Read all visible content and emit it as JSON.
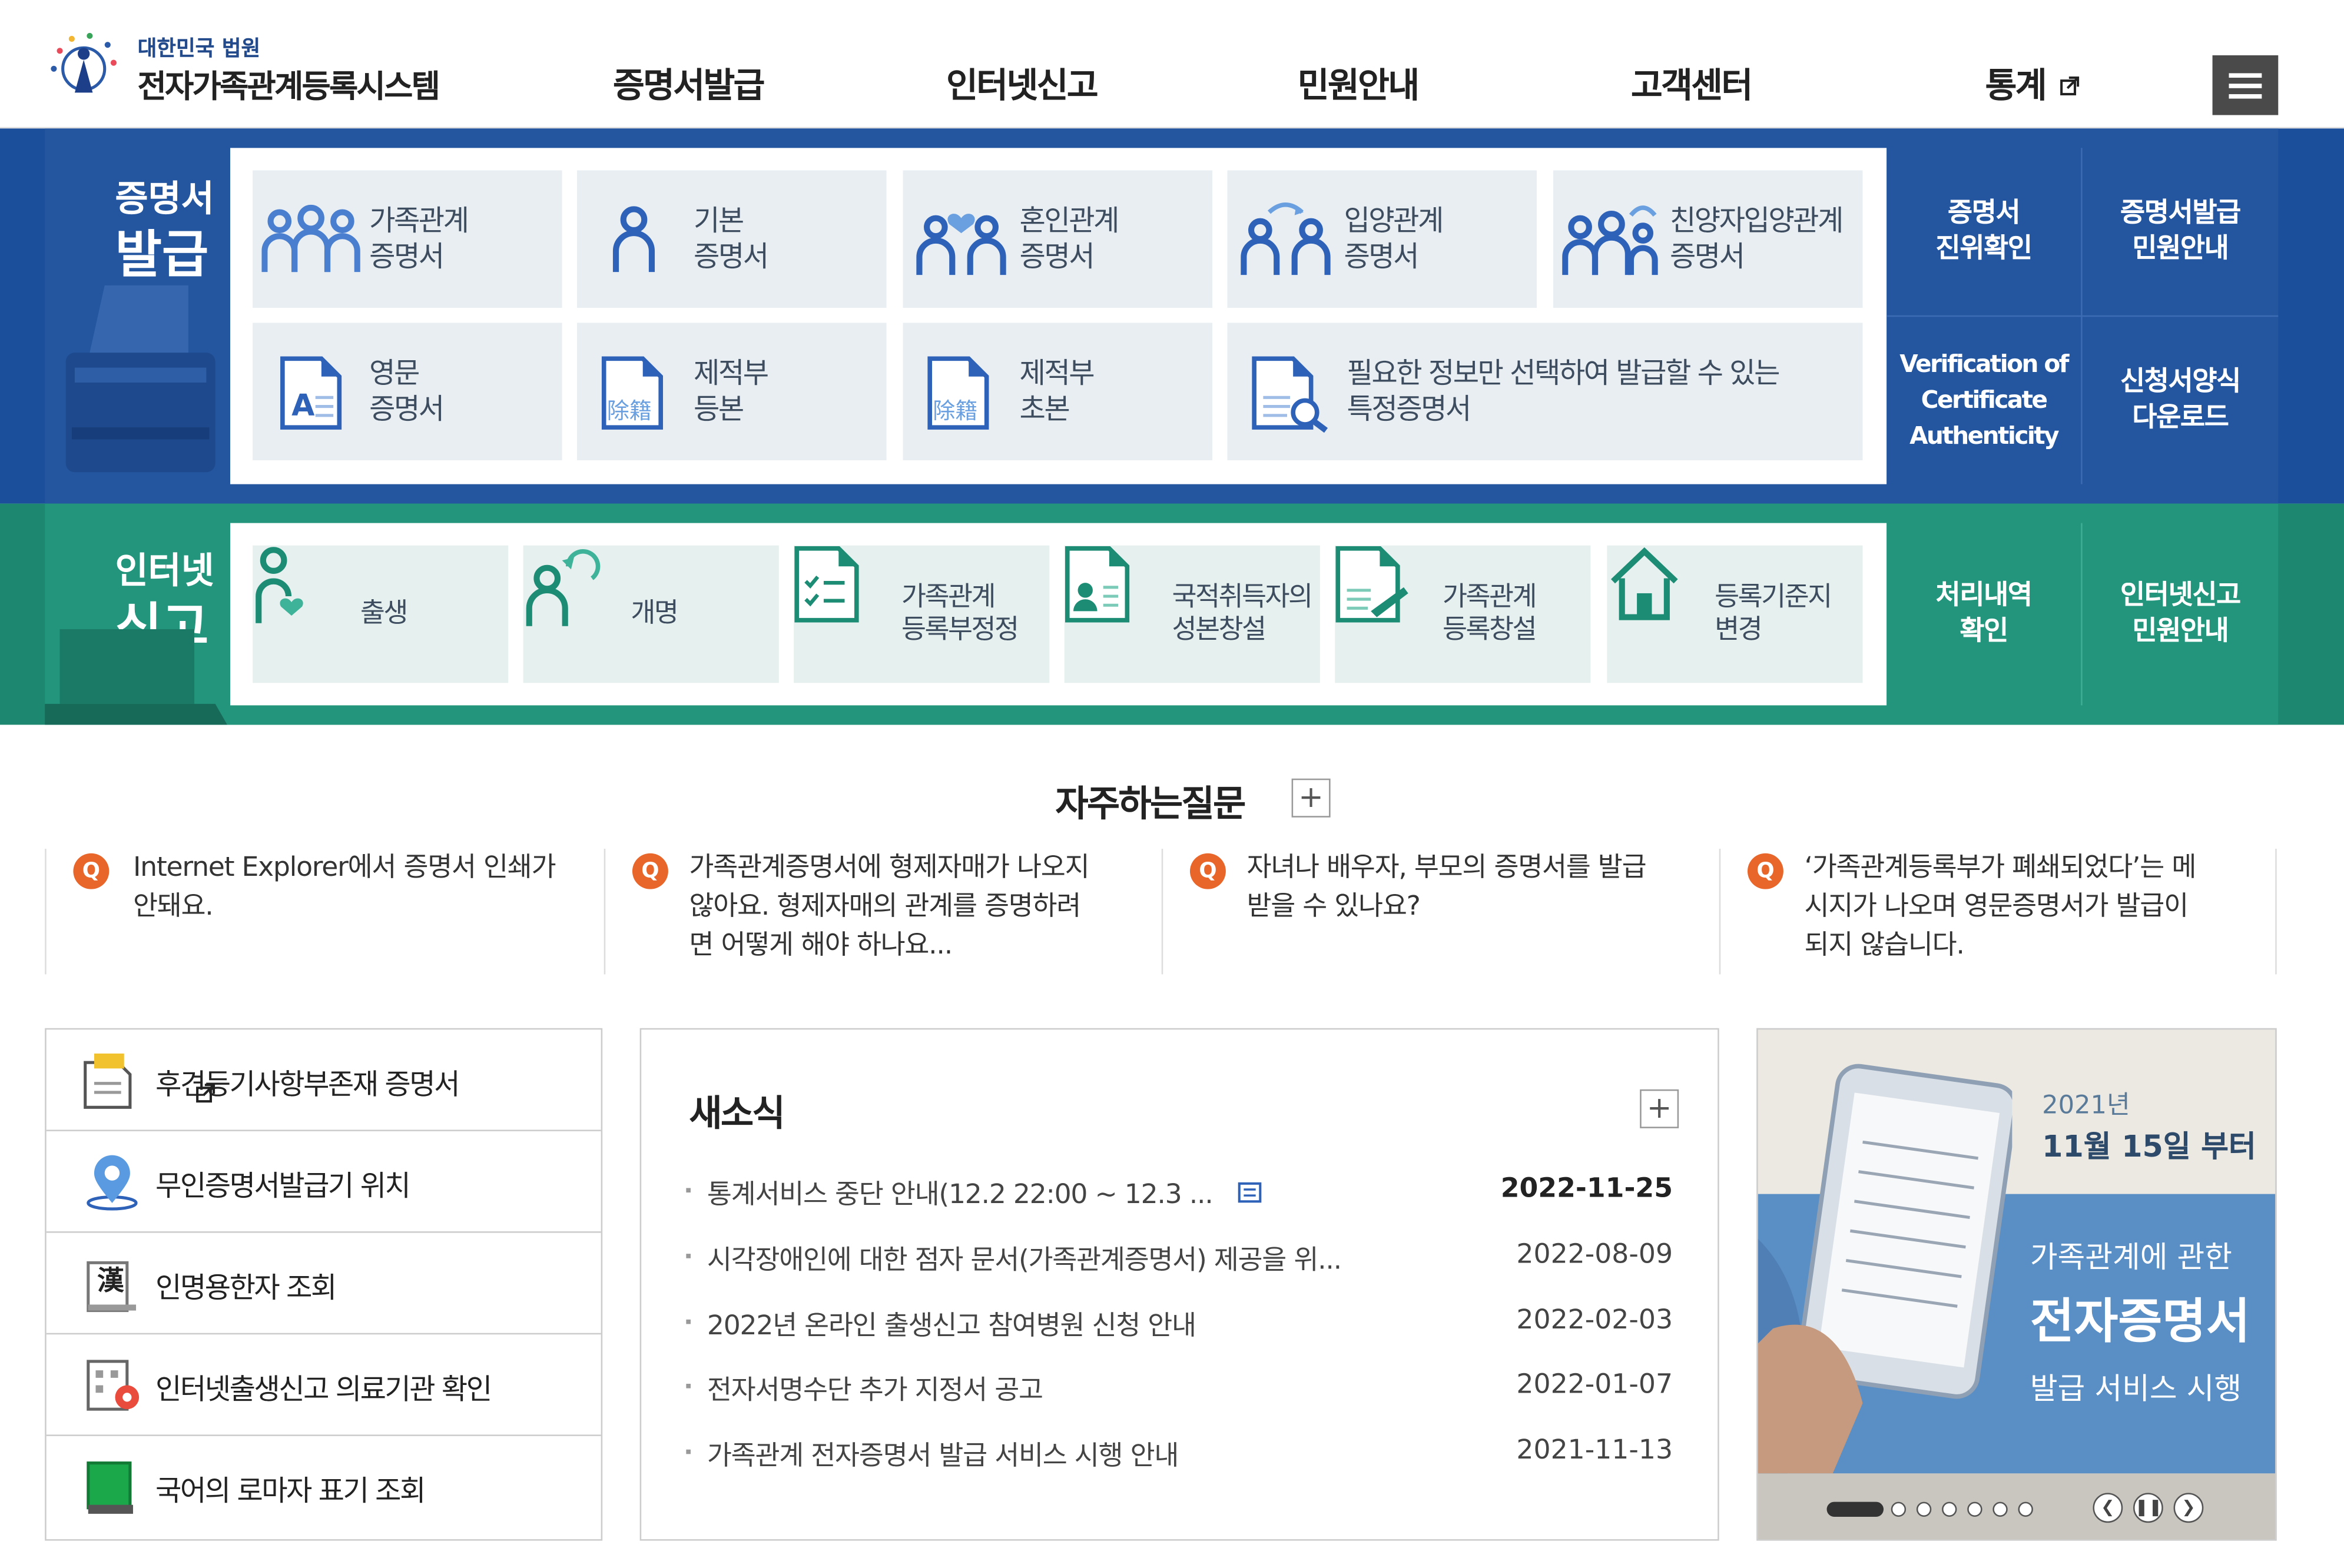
{
  "header": {
    "org": "대한민국 법원",
    "site_name": "전자가족관계등록시스템",
    "nav": [
      "증명서발급",
      "인터넷신고",
      "민원안내",
      "고객센터",
      "통계"
    ],
    "menu_icon": "hamburger-icon"
  },
  "cert": {
    "title_small": "증명서",
    "title_big": "발급",
    "tiles": [
      {
        "label": "가족관계\n증명서",
        "icon": "family-people-icon"
      },
      {
        "label": "기본\n증명서",
        "icon": "person-icon"
      },
      {
        "label": "혼인관계\n증명서",
        "icon": "couple-heart-icon"
      },
      {
        "label": "입양관계\n증명서",
        "icon": "adoption-icon"
      },
      {
        "label": "친양자입양관계\n증명서",
        "icon": "family-adoption-icon"
      },
      {
        "label": "영문\n증명서",
        "icon": "english-document-icon"
      },
      {
        "label": "제적부\n등본",
        "icon": "removed-register-icon"
      },
      {
        "label": "제적부\n초본",
        "icon": "removed-register-icon"
      },
      {
        "label": "필요한 정보만 선택하여 발급할 수 있는\n특정증명서",
        "icon": "document-search-icon"
      }
    ],
    "side": [
      {
        "label": "증명서\n진위확인"
      },
      {
        "label": "증명서발급\n민원안내"
      },
      {
        "label": "Verification of\nCertificate\nAuthenticity"
      },
      {
        "label": "신청서양식\n다운로드"
      }
    ]
  },
  "report": {
    "title_small": "인터넷",
    "title_big": "신고",
    "tiles": [
      {
        "label": "출생",
        "icon": "birth-icon"
      },
      {
        "label": "개명",
        "icon": "rename-icon"
      },
      {
        "label": "가족관계\n등록부정정",
        "icon": "checklist-icon"
      },
      {
        "label": "국적취득자의\n성본창설",
        "icon": "id-card-icon"
      },
      {
        "label": "가족관계\n등록창설",
        "icon": "document-pen-icon"
      },
      {
        "label": "등록기준지\n변경",
        "icon": "house-icon"
      }
    ],
    "side": [
      {
        "label": "처리내역\n확인"
      },
      {
        "label": "인터넷신고\n민원안내"
      }
    ]
  },
  "faq": {
    "title": "자주하는질문",
    "more": "+",
    "q_badge": "Q",
    "items": [
      {
        "line1": "Internet Explorer에서 증명서 인쇄가",
        "line2": "안돼요.",
        "line3": ""
      },
      {
        "line1": "가족관계증명서에 형제자매가 나오지",
        "line2": "않아요. 형제자매의 관계를 증명하려",
        "line3": "면 어떻게 해야 하나요..."
      },
      {
        "line1": "자녀나 배우자, 부모의 증명서를 발급",
        "line2": "받을 수 있나요?",
        "line3": ""
      },
      {
        "line1": "‘가족관계등록부가 폐쇄되었다’는 메",
        "line2": "시지가 나오며 영문증명서가 발급이",
        "line3": "되지 않습니다."
      }
    ]
  },
  "quick": [
    {
      "label": "후견등기사항부존재 증명서",
      "icon": "guardianship-document-icon"
    },
    {
      "label": "무인증명서발급기 위치",
      "icon": "location-pin-icon"
    },
    {
      "label": "인명용한자 조회",
      "icon": "hanja-book-icon",
      "glyph": "漢"
    },
    {
      "label": "인터넷출생신고 의료기관 확인",
      "icon": "hospital-icon"
    },
    {
      "label": "국어의 로마자 표기 조회",
      "icon": "green-book-icon"
    }
  ],
  "news": {
    "title": "새소식",
    "more": "+",
    "items": [
      {
        "title": "통계서비스 중단 안내(12.2 22:00 ~ 12.3 ...",
        "date": "2022-11-25"
      },
      {
        "title": "시각장애인에 대한 점자 문서(가족관계증명서) 제공을 위...",
        "date": "2022-08-09"
      },
      {
        "title": "2022년 온라인 출생신고 참여병원 신청 안내",
        "date": "2022-02-03"
      },
      {
        "title": "전자서명수단 추가 지정서 공고",
        "date": "2022-01-07"
      },
      {
        "title": "가족관계 전자증명서 발급 서비스 시행 안내",
        "date": "2021-11-13"
      }
    ]
  },
  "banner": {
    "year": "2021년",
    "date": "11월 15일 부터",
    "line1": "가족관계에 관한",
    "line2": "전자증명서",
    "line3": "발급 서비스 시행"
  },
  "colors": {
    "cert_blue": "#24569f",
    "report_green": "#22957c",
    "tile_bg": "#e9eef3",
    "faq_badge": "#e8662a"
  }
}
